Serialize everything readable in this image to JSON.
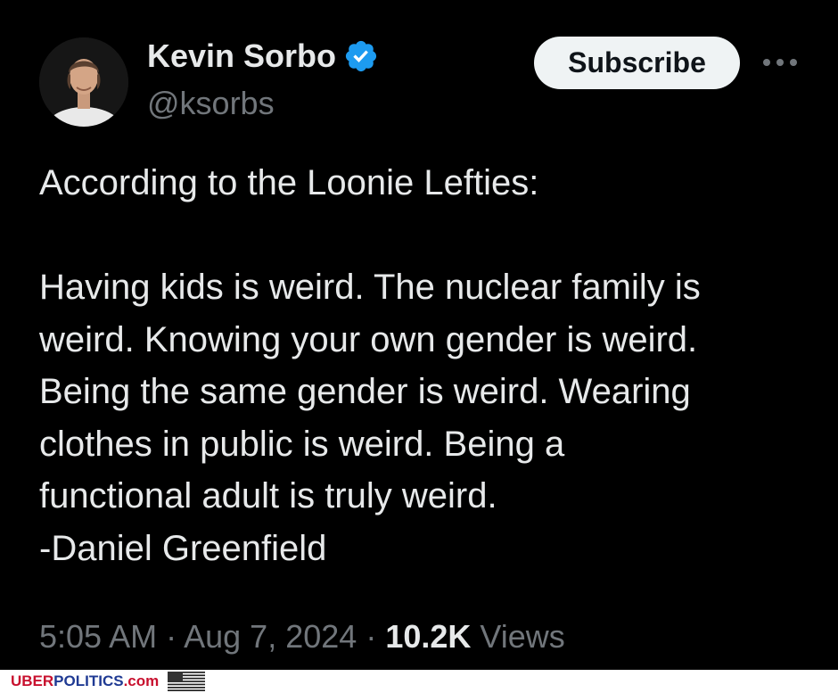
{
  "author": {
    "display_name": "Kevin Sorbo",
    "handle": "@ksorbs",
    "verified": true,
    "avatar_icon": "profile-photo-avatar"
  },
  "actions": {
    "subscribe_label": "Subscribe",
    "more_icon": "ellipsis-icon"
  },
  "tweet": {
    "lines": [
      "According to the Loonie Lefties:",
      "",
      "Having kids is weird. The nuclear family is",
      "weird. Knowing your own gender is weird.",
      "Being the same gender is weird. Wearing",
      "clothes in public is weird. Being a",
      "functional adult is truly weird.",
      "-Daniel Greenfield"
    ]
  },
  "meta": {
    "time": "5:05 AM",
    "separator": "·",
    "date": "Aug 7, 2024",
    "views_count": "10.2K",
    "views_label": "Views"
  },
  "watermark": {
    "part1": "UBER",
    "part2": "POLITICS",
    "part3": ".com",
    "flag_icon": "us-flag-icon"
  },
  "colors": {
    "background": "#000000",
    "primary_text": "#e7e9ea",
    "secondary_text": "#71767b",
    "verified_blue": "#1d9bf0",
    "button_bg": "#eff3f4"
  }
}
